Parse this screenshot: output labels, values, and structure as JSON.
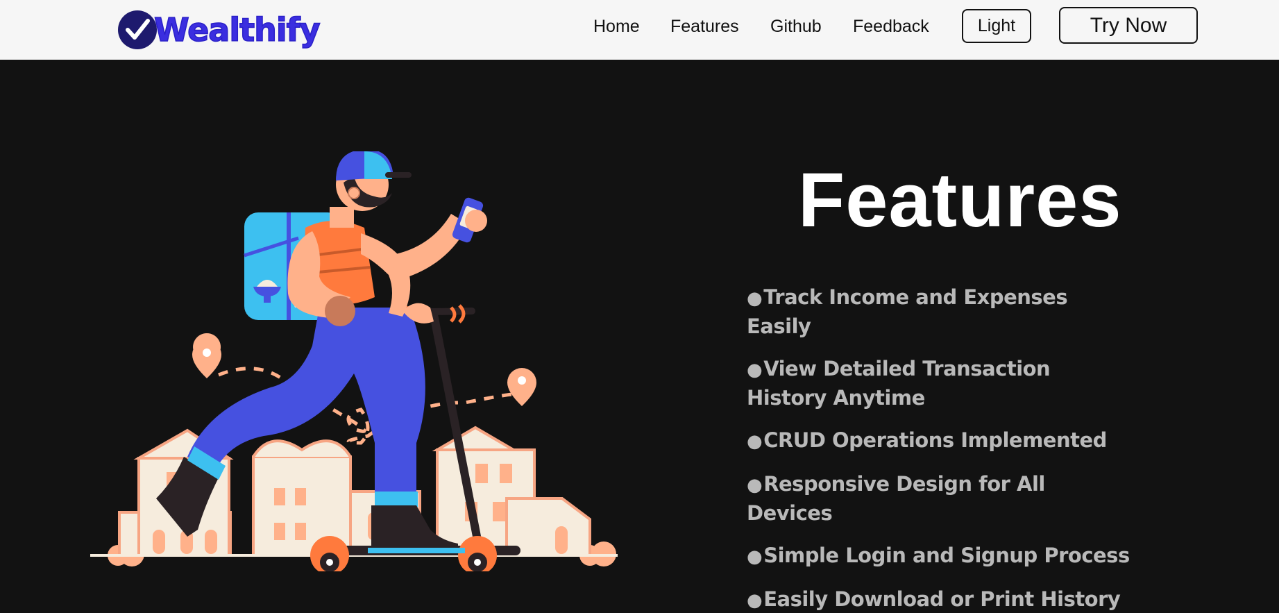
{
  "brand": {
    "name": "Wealthify",
    "color": "#3b2ee0"
  },
  "nav": {
    "links": [
      {
        "label": "Home"
      },
      {
        "label": "Features"
      },
      {
        "label": "Github"
      },
      {
        "label": "Feedback"
      }
    ],
    "theme_toggle_label": "Light",
    "cta_label": "Try Now"
  },
  "hero": {
    "title": "Features",
    "bullet": "●",
    "features": [
      "Track Income and Expenses Easily",
      "View Detailed Transaction History Anytime",
      "CRUD Operations Implemented",
      "Responsive Design for All Devices",
      "Simple Login and Signup Process",
      "Easily Download or Print History"
    ]
  },
  "colors": {
    "background": "#121212",
    "navbar": "#f6f6f6",
    "feature_text": "#b9b9b9",
    "accent_orange": "#ff7a3d",
    "accent_blue": "#4651e0"
  }
}
